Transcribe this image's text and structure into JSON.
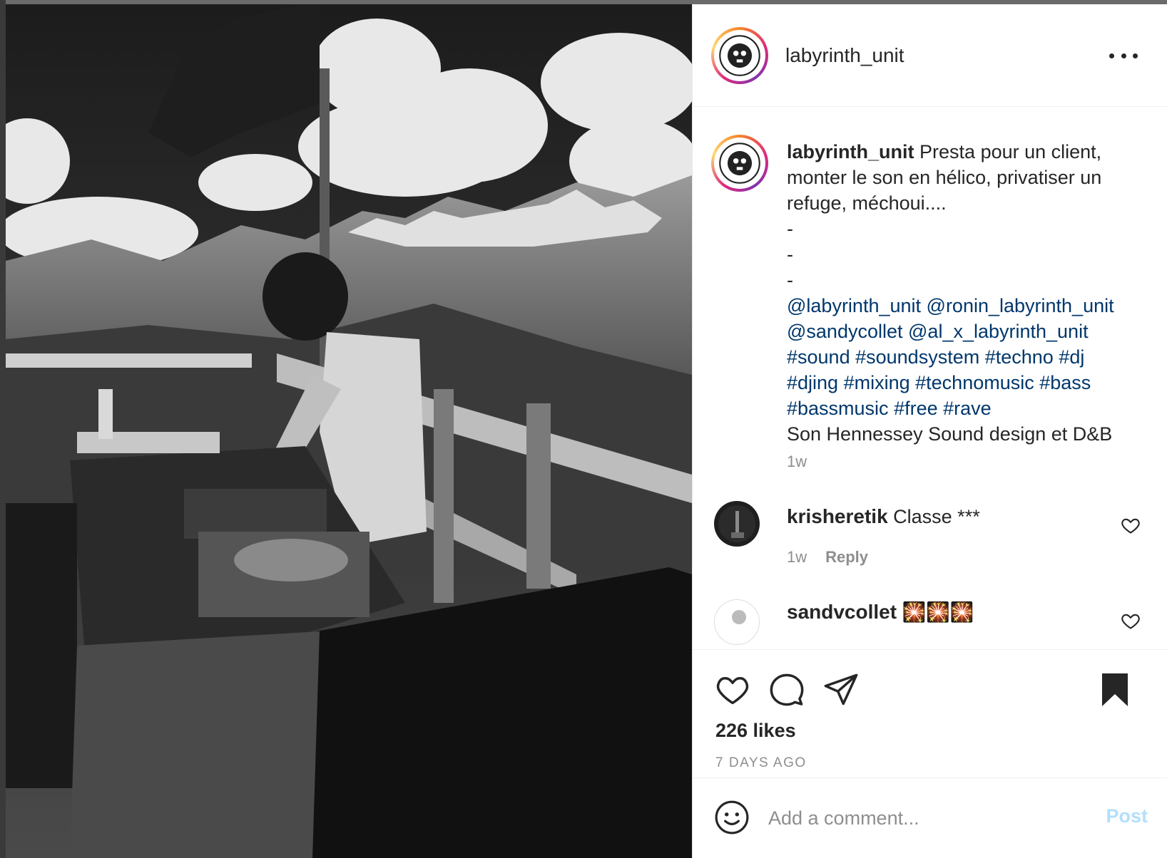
{
  "post": {
    "author": "labyrinth_unit",
    "caption": {
      "username": "labyrinth_unit",
      "text_lines": [
        "Presta pour un client,",
        "monter le son en hélico, privatiser un",
        "refuge, méchoui....",
        "-",
        "-",
        "-"
      ],
      "tags_lines": [
        [
          "@labyrinth_unit",
          "@ronin_labyrinth_unit"
        ],
        [
          "@sandycollet",
          "@al_x_labyrinth_unit"
        ],
        [
          "#sound",
          "#soundsystem",
          "#techno",
          "#dj"
        ],
        [
          "#djing",
          "#mixing",
          "#technomusic",
          "#bass"
        ],
        [
          "#bassmusic",
          "#free",
          "#rave"
        ]
      ],
      "last_line": "Son Hennessey Sound design et D&B",
      "time": "1w"
    },
    "comments": [
      {
        "username": "krisheretik",
        "text": "Classe ***",
        "time": "1w",
        "reply_label": "Reply"
      },
      {
        "username": "sandvcollet",
        "text": "🎇🎇🎇"
      }
    ],
    "likes": "226 likes",
    "posted_ago": "7 DAYS AGO",
    "add_comment": {
      "placeholder": "Add a comment...",
      "post_label": "Post"
    }
  },
  "icons": {
    "more": "more-options-icon",
    "like": "heart-icon",
    "comment": "comment-bubble-icon",
    "share": "paper-plane-icon",
    "save": "bookmark-filled-icon",
    "emoji": "smiley-icon"
  },
  "colors": {
    "link": "#00376b",
    "muted": "#8e8e8e",
    "post_disabled": "#b2dffc",
    "text": "#262626"
  }
}
